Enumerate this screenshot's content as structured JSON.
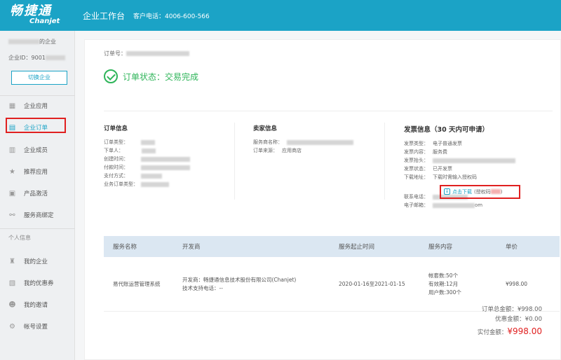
{
  "header": {
    "logo_cn": "畅捷通",
    "logo_en": "Chanjet",
    "workspace_title": "企业工作台",
    "phone_label": "客户电话：4006-600-566"
  },
  "sidebar": {
    "company_name": "的企业",
    "company_id": "企业ID：9001",
    "switch_label": "切换企业",
    "items": [
      {
        "label": "企业应用",
        "icon": "grid-icon"
      },
      {
        "label": "企业订单",
        "icon": "document-icon",
        "active": true
      },
      {
        "label": "企业成员",
        "icon": "building-icon"
      },
      {
        "label": "推荐应用",
        "icon": "star-icon"
      },
      {
        "label": "产品激活",
        "icon": "list-icon"
      },
      {
        "label": "服务商绑定",
        "icon": "link-icon"
      }
    ],
    "personal_section": "个人信息",
    "personal_items": [
      {
        "label": "我的企业",
        "icon": "bottle-icon"
      },
      {
        "label": "我的优惠券",
        "icon": "coupon-icon"
      },
      {
        "label": "我的邀请",
        "icon": "person-icon"
      },
      {
        "label": "帐号设置",
        "icon": "gear-icon"
      }
    ]
  },
  "order": {
    "order_no_label": "订单号：",
    "status_text": "订单状态：交易完成"
  },
  "order_info": {
    "title": "订单信息",
    "rows": [
      {
        "label": "订单类型："
      },
      {
        "label": "下单人："
      },
      {
        "label": "创建时间："
      },
      {
        "label": "付款时间："
      },
      {
        "label": "支付方式："
      },
      {
        "label": "业务订单类型："
      }
    ]
  },
  "seller_info": {
    "title": "卖家信息",
    "rows": [
      {
        "label": "服务商名称：",
        "value": ""
      },
      {
        "label": "订单来源：",
        "value": "应用商店"
      }
    ]
  },
  "invoice_info": {
    "title": "发票信息（30 天内可申请）",
    "rows": [
      {
        "label": "发票类型：",
        "value": "电子普通发票"
      },
      {
        "label": "发票内容：",
        "value": "服务费"
      },
      {
        "label": "发票抬头：",
        "value": ""
      },
      {
        "label": "发票状态：",
        "value": "已开发票"
      },
      {
        "label": "下载地址：",
        "value": "下载时需输入授权码"
      }
    ],
    "download_label": "点击下载",
    "auth_code_prefix": "(授权码",
    "auth_code_suffix": ")",
    "contact_rows": [
      {
        "label": "联系电话：",
        "value": ""
      },
      {
        "label": "电子邮箱：",
        "value": "om"
      }
    ]
  },
  "table": {
    "headers": [
      "服务名称",
      "开发商",
      "服务起止时间",
      "服务内容",
      "单价"
    ],
    "row": {
      "service_name": "易代账运营管理系统",
      "developer": "开发商：畅捷通信息技术股份有限公司(Chanjet)",
      "support_phone": "技术支持电话：--",
      "period": "2020-01-16至2021-01-15",
      "content": [
        "帐套数:50个",
        "有效期:12月",
        "用户数:300个"
      ],
      "price": "¥998.00"
    }
  },
  "totals": {
    "order_total_label": "订单总金额：",
    "order_total": "¥998.00",
    "discount_label": "优惠金额：",
    "discount": "¥0.00",
    "paid_label": "实付金额：",
    "paid": "¥998.00"
  },
  "colors": {
    "brand": "#1ba3c6",
    "success": "#2fb55a",
    "alert": "#e02020"
  }
}
